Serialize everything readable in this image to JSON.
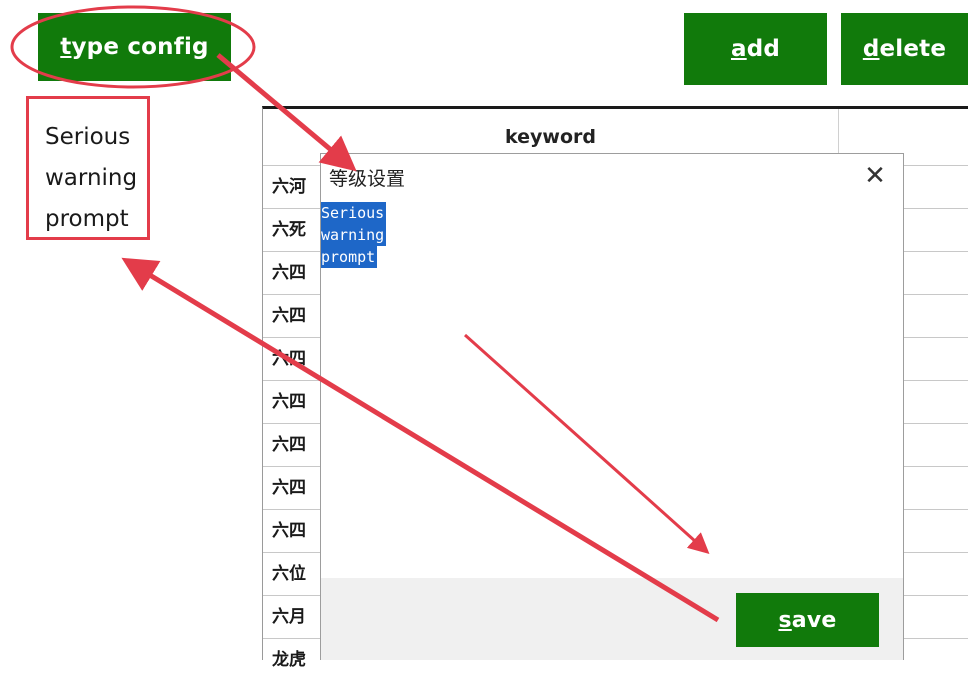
{
  "toolbar": {
    "type_config": {
      "accel": "t",
      "rest": "ype config"
    },
    "add": {
      "accel": "a",
      "rest": "dd"
    },
    "delete": {
      "accel": "d",
      "rest": "elete"
    }
  },
  "level_box": {
    "lines": [
      "Serious",
      "warning",
      "prompt"
    ]
  },
  "table": {
    "header": "keyword",
    "rows": [
      "六河",
      "六死",
      "六四",
      "六四",
      "六四",
      "六四",
      "六四",
      "六四",
      "六四",
      "六位",
      "六月",
      "龙虎"
    ]
  },
  "dialog": {
    "title": "等级设置",
    "close_glyph": "✕",
    "text_lines": [
      "Serious",
      "warning",
      "prompt"
    ],
    "save": {
      "accel": "s",
      "rest": "ave"
    }
  },
  "colors": {
    "button_green": "#117a0b",
    "annotation_red": "#e33c4a",
    "selection_blue": "#1e67c8"
  }
}
